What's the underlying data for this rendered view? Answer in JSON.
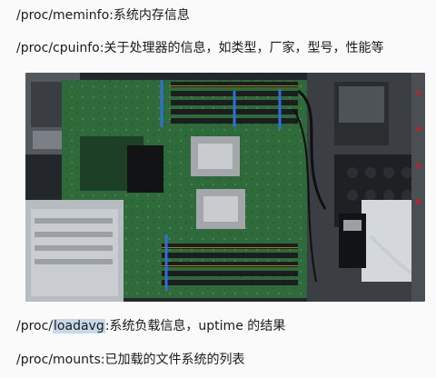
{
  "lines": {
    "meminfo": "/proc/meminfo:系统内存信息",
    "cpuinfo": "/proc/cpuinfo:关于处理器的信息，如类型，厂家，型号，性能等",
    "loadavg_prefix": "/proc/",
    "loadavg_highlight": "loadavg",
    "loadavg_suffix": ":系统负载信息，uptime 的结果",
    "mounts": "/proc/mounts:已加载的文件系统的列表"
  },
  "photo": {
    "description": "",
    "colors": {
      "pcb": "#2f6b3a",
      "chassis": "#9aa0a6",
      "dimm": "#1b1d1f",
      "accent": "#2f6fd6"
    }
  }
}
